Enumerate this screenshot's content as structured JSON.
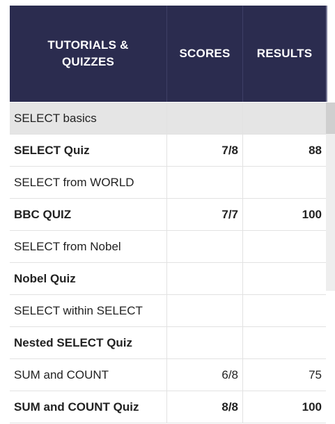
{
  "table": {
    "headers": {
      "tutorials_line1": "TUTORIALS &",
      "tutorials_line2": "QUIZZES",
      "scores": "SCORES",
      "results": "RESULTS"
    },
    "rows": [
      {
        "name": "SELECT basics",
        "score": "",
        "result": "",
        "bold": false,
        "highlighted": true
      },
      {
        "name": "SELECT Quiz",
        "score": "7/8",
        "result": "88",
        "bold": true,
        "highlighted": false
      },
      {
        "name": "SELECT from WORLD",
        "score": "",
        "result": "",
        "bold": false,
        "highlighted": false
      },
      {
        "name": "BBC QUIZ",
        "score": "7/7",
        "result": "100",
        "bold": true,
        "highlighted": false
      },
      {
        "name": "SELECT from Nobel",
        "score": "",
        "result": "",
        "bold": false,
        "highlighted": false
      },
      {
        "name": "Nobel Quiz",
        "score": "",
        "result": "",
        "bold": true,
        "highlighted": false
      },
      {
        "name": "SELECT within SELECT",
        "score": "",
        "result": "",
        "bold": false,
        "highlighted": false
      },
      {
        "name": "Nested SELECT Quiz",
        "score": "",
        "result": "",
        "bold": true,
        "highlighted": false
      },
      {
        "name": "SUM and COUNT",
        "score": "6/8",
        "result": "75",
        "bold": false,
        "highlighted": false
      },
      {
        "name": "SUM and COUNT Quiz",
        "score": "8/8",
        "result": "100",
        "bold": true,
        "highlighted": false
      }
    ]
  },
  "colors": {
    "header_bg": "#2b2c4f",
    "header_text": "#ffffff",
    "highlight_row": "#e5e5e5"
  }
}
